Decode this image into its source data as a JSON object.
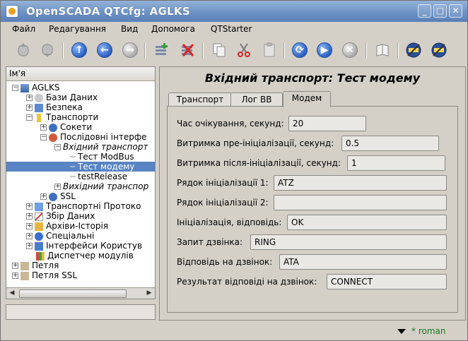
{
  "window": {
    "title": "OpenSCADA QTCfg: AGLKS"
  },
  "menu": [
    "Файл",
    "Редагування",
    "Вид",
    "Допомога",
    "QTStarter"
  ],
  "left_header": "Ім'я",
  "tree": [
    {
      "label": "AGLKS"
    },
    {
      "label": "Бази Даних"
    },
    {
      "label": "Безпека"
    },
    {
      "label": "Транспорти"
    },
    {
      "label": "Сокети"
    },
    {
      "label": "Послідовні інтерфе"
    },
    {
      "label": "Вхідний транспорт"
    },
    {
      "label": "Тест ModBus"
    },
    {
      "label": "Тест модему"
    },
    {
      "label": "testRelease"
    },
    {
      "label": "Вихідний транспор"
    },
    {
      "label": "SSL"
    },
    {
      "label": "Транспортні Протоко"
    },
    {
      "label": "Збір Даних"
    },
    {
      "label": "Архіви-Історія"
    },
    {
      "label": "Спеціальні"
    },
    {
      "label": "Інтерфейси Користув"
    },
    {
      "label": "Диспетчер модулів"
    },
    {
      "label": "Петля"
    },
    {
      "label": "Петля SSL"
    }
  ],
  "panel": {
    "title": "Вхідний транспорт: Тест модему",
    "tabs": [
      "Транспорт",
      "Лог ВВ",
      "Модем"
    ],
    "fields": [
      {
        "label": "Час очікування, секунд:",
        "value": "20"
      },
      {
        "label": "Витримка пре-ініціалізації, секунд:",
        "value": "0.5"
      },
      {
        "label": "Витримка після-ініціалізації, секунд:",
        "value": "1"
      },
      {
        "label": "Рядок ініціалізації 1:",
        "value": "ATZ"
      },
      {
        "label": "Рядок ініціалізації 2:",
        "value": ""
      },
      {
        "label": "Ініціалізація, відповідь:",
        "value": "OK"
      },
      {
        "label": "Запит дзвінка:",
        "value": "RING"
      },
      {
        "label": "Відповідь на дзвінок:",
        "value": "ATA"
      },
      {
        "label": "Результат відповіді на дзвінок:",
        "value": "CONNECT"
      }
    ]
  },
  "status": {
    "user": "* roman"
  },
  "colors": {
    "titlebar": "#6a8fc3",
    "selection": "#5884c4",
    "user": "#1a7a1a"
  }
}
